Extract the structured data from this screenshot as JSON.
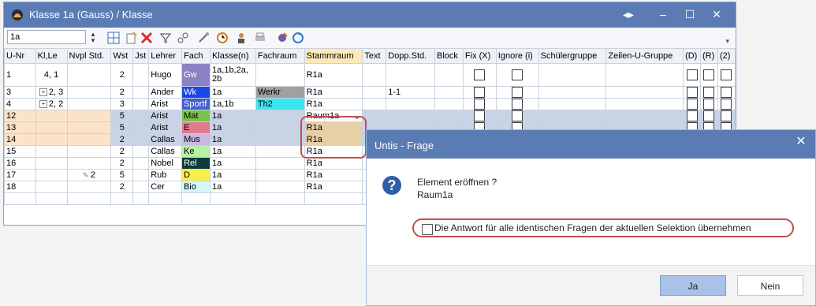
{
  "window": {
    "title": "Klasse 1a (Gauss) / Klasse",
    "controls": [
      "◂▸",
      "–",
      "☐",
      "✕"
    ]
  },
  "toolbar": {
    "class_value": "1a",
    "icons": [
      "grid-icon",
      "new-icon",
      "delete-icon",
      "filter-icon",
      "link-icon",
      "wand-icon",
      "clock-icon",
      "teacher-icon",
      "print-icon",
      "settings-icon",
      "refresh-icon"
    ]
  },
  "table": {
    "headers": [
      "U-Nr",
      "Kl,Le",
      "Nvpl Std.",
      "Wst",
      "Jst",
      "Lehrer",
      "Fach",
      "Klasse(n)",
      "Fachraum",
      "Stammraum",
      "Text",
      "Dopp.Std.",
      "Block",
      "Fix (X)",
      "Ignore (i)",
      "Schülergruppe",
      "Zeilen-U-Gruppe",
      "(D)",
      "(R)",
      "(2)"
    ],
    "rows": [
      {
        "unr": "1",
        "kl": "4, 1",
        "nvpl": "",
        "wst": "2",
        "jst": "",
        "lehrer": "Hugo",
        "fach": "Gw",
        "fach_bg": "#8a82c4",
        "fach_fg": "#ffffff",
        "klassen": "1a,1b,2a, 2b",
        "fachraum": "",
        "fachraum_bg": "",
        "stamm": "R1a",
        "dopp": "",
        "tall": true,
        "sel": false
      },
      {
        "unr": "3",
        "kl": "2, 3",
        "nvpl": "",
        "wst": "2",
        "jst": "",
        "lehrer": "Ander",
        "fach": "Wk",
        "fach_bg": "#1a47e8",
        "fach_fg": "#ffffff",
        "klassen": "1a",
        "fachraum": "Werkr",
        "fachraum_bg": "#a0a0a0",
        "stamm": "R1a",
        "dopp": "1-1",
        "tall": false,
        "sel": false,
        "plus": true
      },
      {
        "unr": "4",
        "kl": "2, 2",
        "nvpl": "",
        "wst": "3",
        "jst": "",
        "lehrer": "Arist",
        "fach": "Sportf",
        "fach_bg": "#3f5fd6",
        "fach_fg": "#ffffff",
        "klassen": "1a,1b",
        "fachraum": "Th2",
        "fachraum_bg": "#39e6f0",
        "stamm": "R1a",
        "dopp": "",
        "tall": false,
        "sel": false,
        "plus": true
      },
      {
        "unr": "12",
        "kl": "",
        "nvpl": "",
        "wst": "5",
        "jst": "",
        "lehrer": "Arist",
        "fach": "Mat",
        "fach_bg": "#78c24a",
        "fach_fg": "#000000",
        "klassen": "1a",
        "fachraum": "",
        "fachraum_bg": "",
        "stamm": "Raum1a",
        "dopp": "",
        "tall": false,
        "sel": true
      },
      {
        "unr": "13",
        "kl": "",
        "nvpl": "",
        "wst": "5",
        "jst": "",
        "lehrer": "Arist",
        "fach": "E",
        "fach_bg": "#e07a8c",
        "fach_fg": "#000000",
        "klassen": "1a",
        "fachraum": "",
        "fachraum_bg": "",
        "stamm": "R1a",
        "dopp": "",
        "tall": false,
        "sel": true
      },
      {
        "unr": "14",
        "kl": "",
        "nvpl": "",
        "wst": "2",
        "jst": "",
        "lehrer": "Callas",
        "fach": "Mus",
        "fach_bg": "#c8b9e0",
        "fach_fg": "#000000",
        "klassen": "1a",
        "fachraum": "",
        "fachraum_bg": "",
        "stamm": "R1a",
        "dopp": "",
        "tall": false,
        "sel": true
      },
      {
        "unr": "15",
        "kl": "",
        "nvpl": "",
        "wst": "2",
        "jst": "",
        "lehrer": "Callas",
        "fach": "Ke",
        "fach_bg": "#b8f0a8",
        "fach_fg": "#000000",
        "klassen": "1a",
        "fachraum": "",
        "fachraum_bg": "",
        "stamm": "R1a",
        "dopp": "",
        "tall": false,
        "sel": false
      },
      {
        "unr": "16",
        "kl": "",
        "nvpl": "",
        "wst": "2",
        "jst": "",
        "lehrer": "Nobel",
        "fach": "Rel",
        "fach_bg": "#0e3a3a",
        "fach_fg": "#ffffff",
        "klassen": "1a",
        "fachraum": "",
        "fachraum_bg": "",
        "stamm": "R1a",
        "dopp": "",
        "tall": false,
        "sel": false
      },
      {
        "unr": "17",
        "kl": "",
        "nvpl": "2",
        "wst": "5",
        "jst": "",
        "lehrer": "Rub",
        "fach": "D",
        "fach_bg": "#f8f04a",
        "fach_fg": "#000000",
        "klassen": "1a",
        "fachraum": "",
        "fachraum_bg": "",
        "stamm": "R1a",
        "dopp": "",
        "tall": false,
        "sel": false
      },
      {
        "unr": "18",
        "kl": "",
        "nvpl": "",
        "wst": "2",
        "jst": "",
        "lehrer": "Cer",
        "fach": "Bio",
        "fach_bg": "#d4f7f9",
        "fach_fg": "#000000",
        "klassen": "1a",
        "fachraum": "",
        "fachraum_bg": "",
        "stamm": "R1a",
        "dopp": "",
        "tall": false,
        "sel": false
      }
    ]
  },
  "dialog": {
    "title": "Untis - Frage",
    "question": "Element eröffnen ?",
    "element": "Raum1a",
    "checkbox_label": "Die Antwort für alle identischen Fragen der aktuellen Selektion übernehmen",
    "yes": "Ja",
    "no": "Nein"
  }
}
